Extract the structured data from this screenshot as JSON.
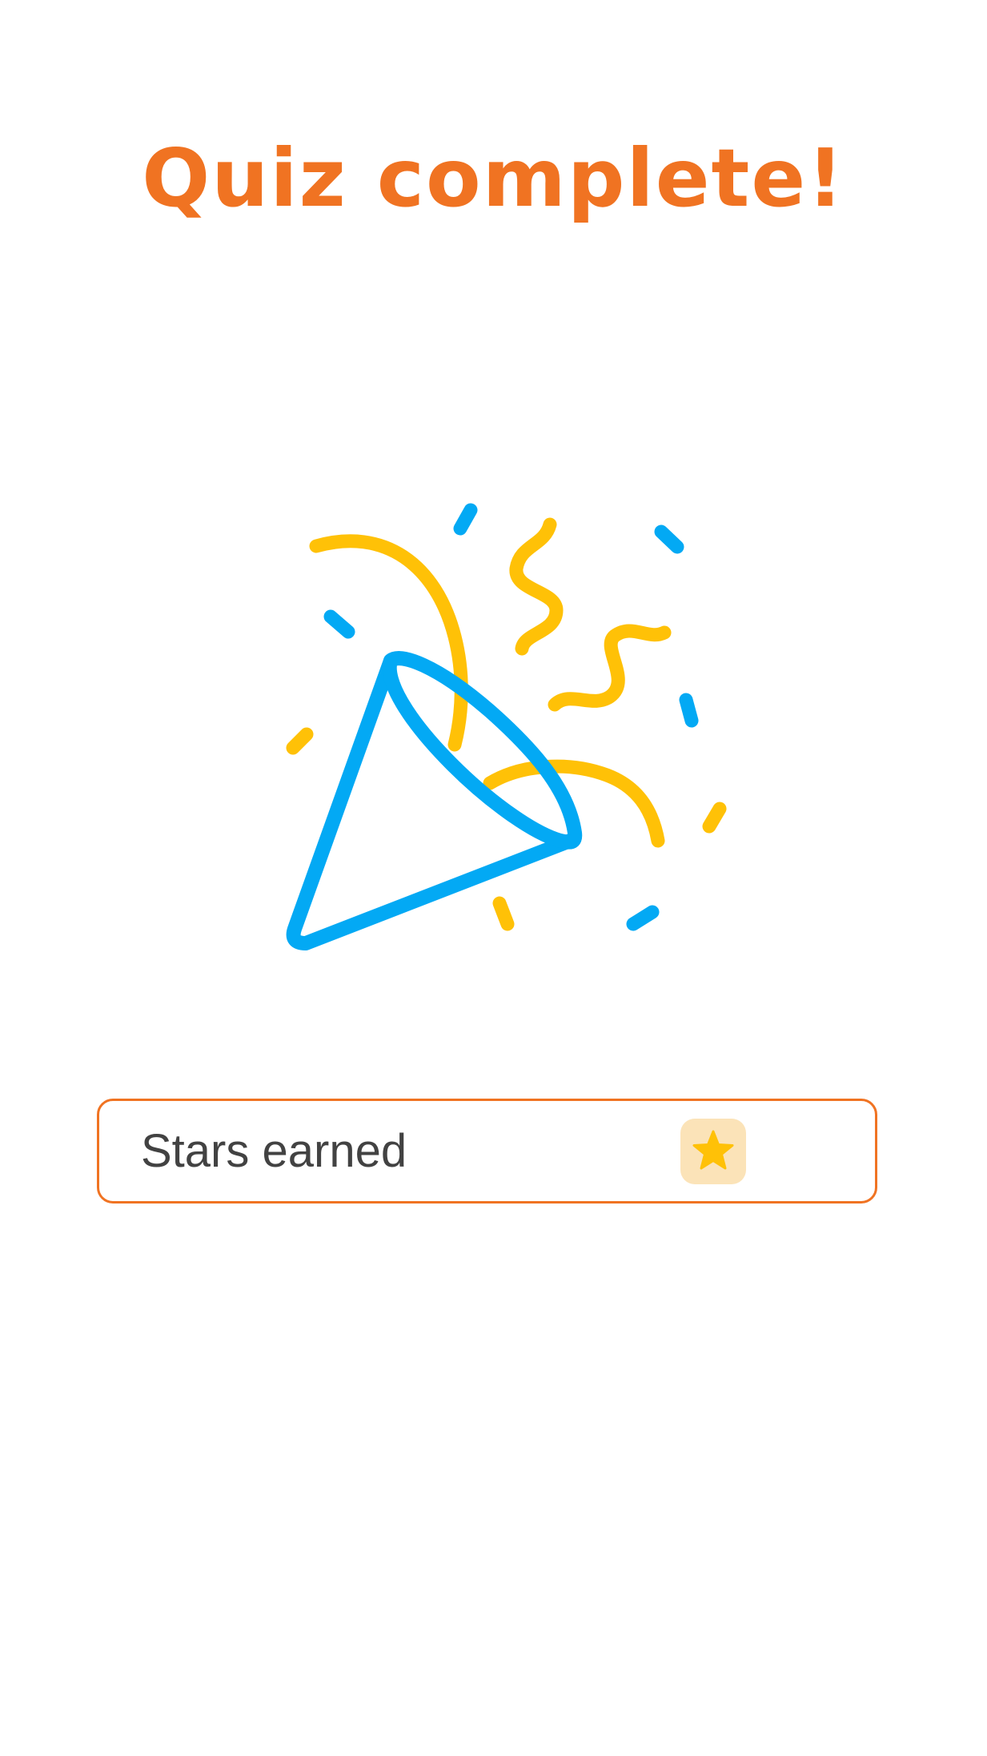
{
  "screen": {
    "title": "Quiz complete!"
  },
  "illustration": {
    "icon": "party-popper-icon",
    "colors": {
      "cone": "#03a9f4",
      "confetti_blue": "#03a9f4",
      "confetti_yellow": "#ffc107"
    }
  },
  "stars_card": {
    "label": "Stars earned",
    "icon": "star-icon"
  },
  "colors": {
    "accent": "#f07322",
    "text": "#424242",
    "star": "#ffc107",
    "star_badge_bg": "#fbe3b8",
    "background": "#ffffff"
  }
}
